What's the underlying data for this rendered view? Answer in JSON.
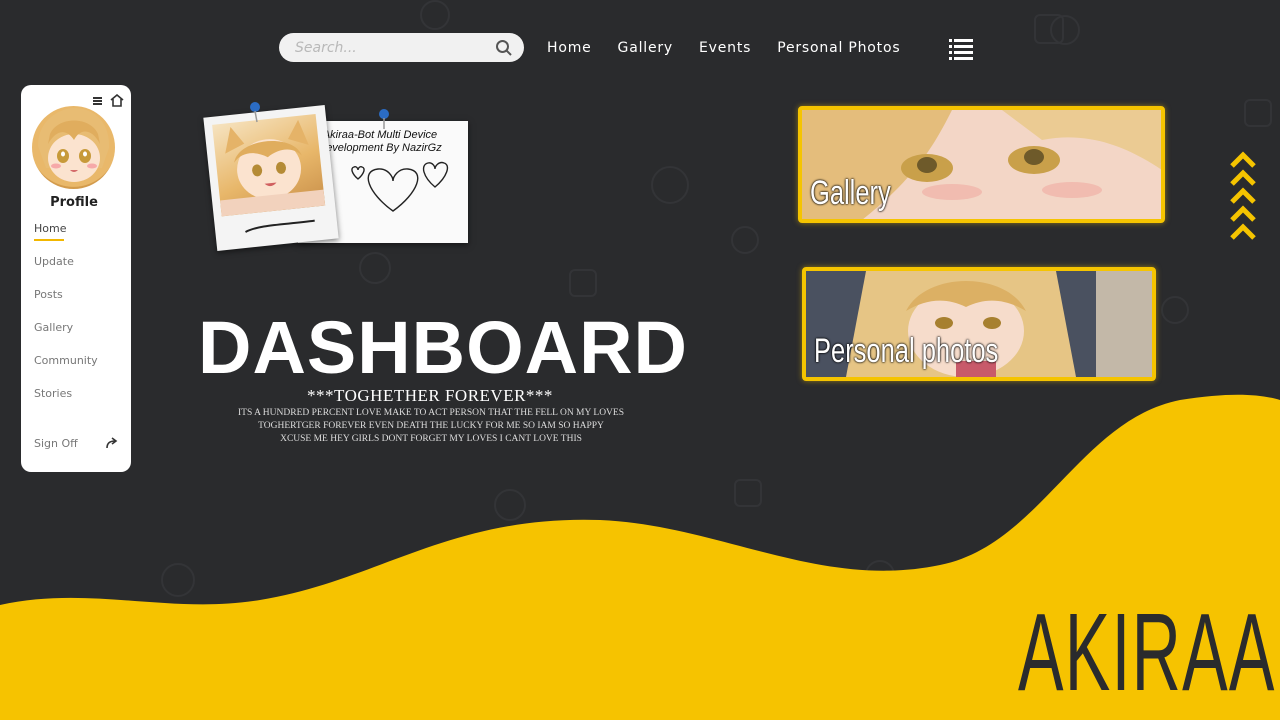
{
  "search": {
    "placeholder": "Search..."
  },
  "nav": {
    "items": [
      "Home",
      "Gallery",
      "Events",
      "Personal Photos"
    ]
  },
  "sidebar": {
    "title": "Profile",
    "items": [
      "Home",
      "Update",
      "Posts",
      "Gallery",
      "Community",
      "Stories"
    ],
    "signoff": "Sign Off"
  },
  "note": {
    "text": "Akiraa-Bot Multi Device Development By NazirGz"
  },
  "hero": {
    "title": "DASHBOARD",
    "tagline": "***TOGHETHER FOREVER***",
    "lines": [
      "ITS A HUNDRED PERCENT LOVE MAKE TO ACT PERSON THAT THE FELL ON MY LOVES",
      "TOGHERTGER FOREVER EVEN DEATH THE LUCKY FOR ME SO IAM SO HAPPY",
      "XCUSE ME HEY GIRLS DONT FORGET MY LOVES I CANT LOVE THIS"
    ]
  },
  "banners": {
    "gallery": "Gallery",
    "personal": "Personal photos"
  },
  "brand": "AKIRAA",
  "colors": {
    "background": "#2a2b2d",
    "accent": "#f5c400"
  }
}
